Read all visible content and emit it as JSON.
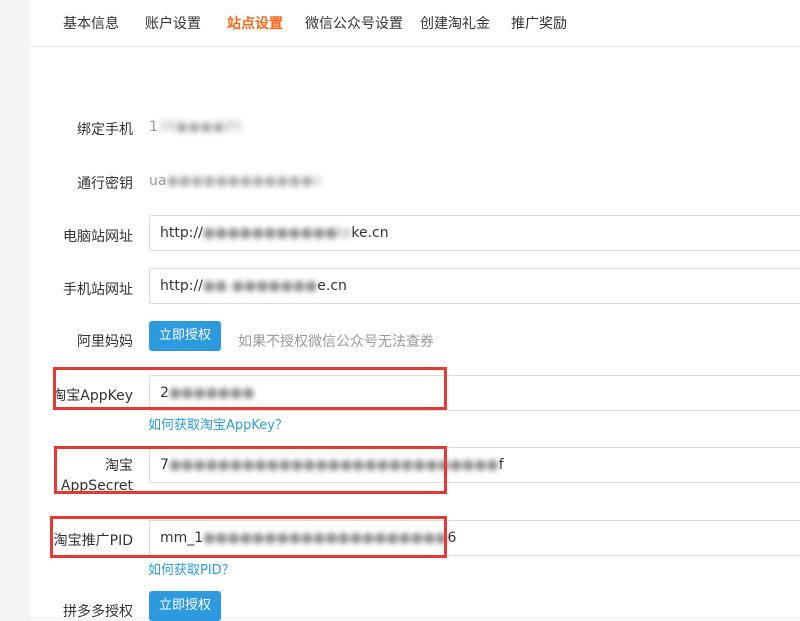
{
  "tabs": [
    {
      "label": "基本信息"
    },
    {
      "label": "账户设置"
    },
    {
      "label": "站点设置",
      "active": true
    },
    {
      "label": "微信公众号设置"
    },
    {
      "label": "创建淘礼金"
    },
    {
      "label": "推广奖励"
    }
  ],
  "form": {
    "phone": {
      "label": "绑定手机",
      "value_prefix": "1",
      "value_blurred": "38●●●●85"
    },
    "secret": {
      "label": "通行密钥",
      "value_prefix": "ua",
      "value_blurred": "●●●●●●●●●●●●o"
    },
    "pc_url": {
      "label": "电脑站网址",
      "prefix": "http://",
      "blurred": "●●●●●●●●●●●ta",
      "suffix": "ke.cn"
    },
    "mobile_url": {
      "label": "手机站网址",
      "prefix": "http://",
      "blurred": "●● ●●●●●●●",
      "suffix": "e.cn"
    },
    "alimama": {
      "label": "阿里妈妈",
      "button": "立即授权",
      "hint": "如果不授权微信公众号无法查券"
    },
    "appkey": {
      "label": "淘宝AppKey",
      "prefix": "2",
      "blurred": "●●●●●●●",
      "help_link": "如何获取淘宝AppKey？"
    },
    "appsecret": {
      "label": "淘宝AppSecret",
      "prefix": "7",
      "blurred": "●●●●●●●●●●●●●●●●●●●●●●●●●●●",
      "suffix": "f"
    },
    "pid": {
      "label": "淘宝推广PID",
      "prefix": "mm_1",
      "blurred": "●●●●●●●●●●●●●●●●●●●●",
      "suffix": "6",
      "help_link": "如何获取PID？"
    },
    "pdd": {
      "label": "拼多多授权",
      "button": "立即授权"
    }
  },
  "colors": {
    "accent": "#f56a1e",
    "primary": "#2d9ae0",
    "highlight": "#e53935"
  }
}
